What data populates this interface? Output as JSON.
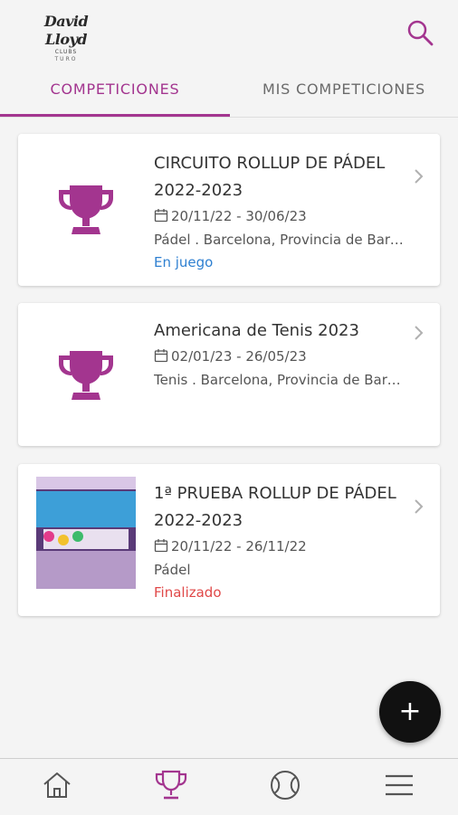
{
  "header": {
    "logo_main": "David Lloyd",
    "logo_sub": "CLUBS",
    "logo_city": "TURO",
    "search_icon": "search-icon"
  },
  "tabs": [
    {
      "label": "COMPETICIONES",
      "active": true
    },
    {
      "label": "MIS COMPETICIONES",
      "active": false
    }
  ],
  "competitions": [
    {
      "title": "CIRCUITO ROLLUP DE PÁDEL 2022-2023",
      "dates": "20/11/22 - 30/06/23",
      "location": "Pádel . Barcelona, Provincia de Barcelona",
      "status": "En juego",
      "image": "trophy-icon"
    },
    {
      "title": "Americana de Tenis 2023",
      "dates": "02/01/23 - 26/05/23",
      "location": "Tenis . Barcelona, Provincia de Barcelona",
      "status": "",
      "image": "trophy-icon"
    },
    {
      "title": "1ª PRUEBA ROLLUP DE PÁDEL 2022-2023",
      "dates": "20/11/22 - 26/11/22",
      "location": "Pádel",
      "status": "Finalizado",
      "image": "event-poster"
    }
  ],
  "fab": {
    "label": "+"
  },
  "bottom_nav": [
    {
      "icon": "home-icon"
    },
    {
      "icon": "trophy-icon",
      "active": true
    },
    {
      "icon": "tennis-ball-icon"
    },
    {
      "icon": "menu-icon"
    }
  ],
  "colors": {
    "accent": "#a3358f",
    "status_playing": "#2f80d1",
    "status_finished": "#e04848"
  }
}
